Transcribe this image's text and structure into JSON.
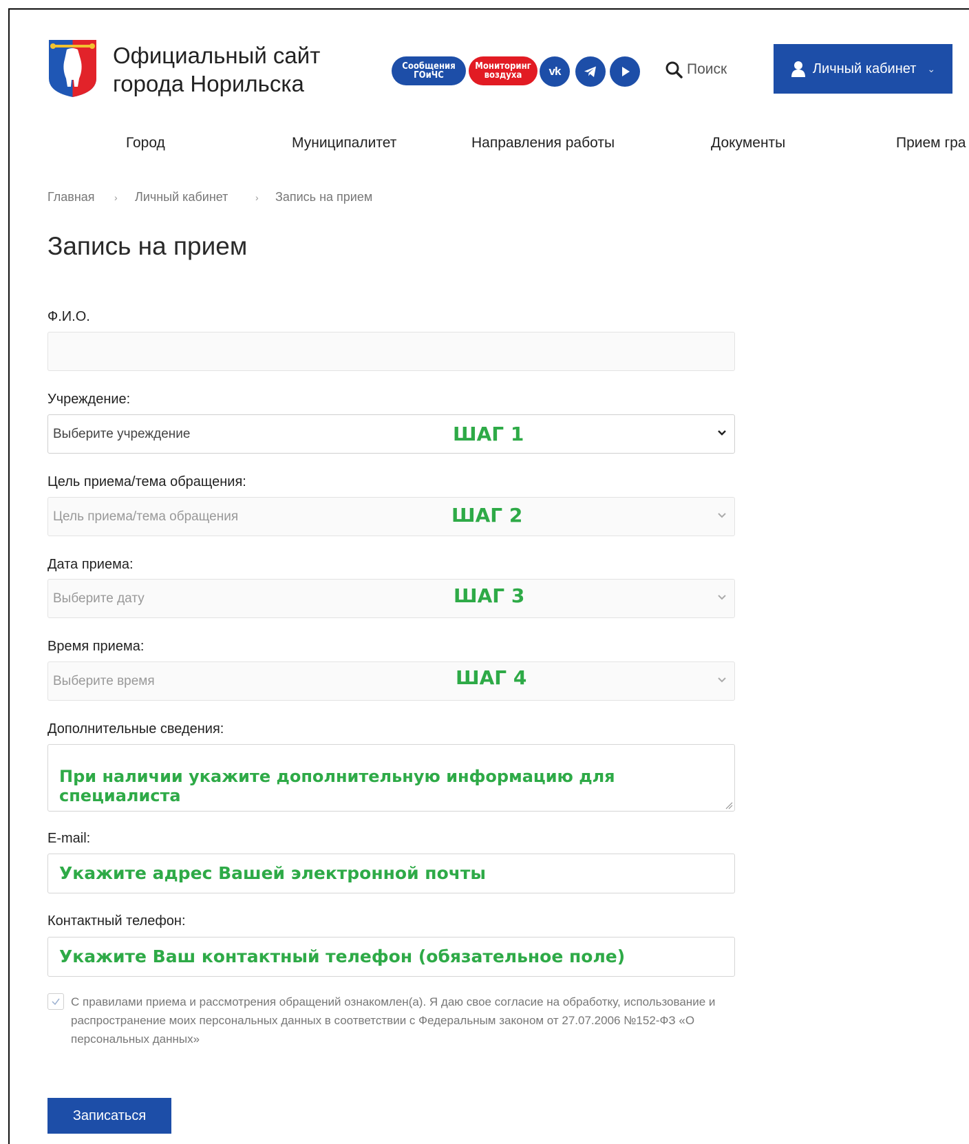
{
  "header": {
    "site_title_line1": "Официальный сайт",
    "site_title_line2": "города Норильска",
    "pill_messages_line1": "Сообщения",
    "pill_messages_line2": "ГОиЧС",
    "pill_monitoring_line1": "Мониторинг",
    "pill_monitoring_line2": "воздуха",
    "vk_label": "vk",
    "search_label": "Поиск",
    "cabinet_label": "Личный кабинет"
  },
  "nav": {
    "items": [
      "Город",
      "Муниципалитет",
      "Направления работы",
      "Документы",
      "Прием гра"
    ]
  },
  "breadcrumb": {
    "items": [
      "Главная",
      "Личный кабинет",
      "Запись на прием"
    ],
    "separator": "›"
  },
  "page": {
    "title": "Запись на прием"
  },
  "form": {
    "fio_label": "Ф.И.О.",
    "institution_label": "Учреждение:",
    "institution_placeholder": "Выберите учреждение",
    "institution_step": "ШАГ 1",
    "purpose_label": "Цель приема/тема обращения:",
    "purpose_placeholder": "Цель приема/тема обращения",
    "purpose_step": "ШАГ 2",
    "date_label": "Дата приема:",
    "date_placeholder": "Выберите дату",
    "date_step": "ШАГ 3",
    "time_label": "Время приема:",
    "time_placeholder": "Выберите время",
    "time_step": "ШАГ 4",
    "extra_label": "Дополнительные сведения:",
    "extra_hint": "При наличии укажите дополнительную информацию для специалиста",
    "email_label": "E-mail:",
    "email_hint": "Укажите адрес Вашей электронной почты",
    "phone_label": "Контактный телефон:",
    "phone_hint": "Укажите Ваш контактный телефон (обязательное поле)",
    "consent_text": "С правилами приема и рассмотрения обращений ознакомлен(а). Я даю свое согласие на обработку, использование и распространение моих персональных данных в соответствии с Федеральным законом от 27.07.2006 №152-ФЗ «О персональных данных»",
    "submit_label": "Записаться"
  },
  "colors": {
    "brand_blue": "#1d4ea8",
    "alert_red": "#e21b23",
    "annotation_green": "#2eaa47"
  }
}
